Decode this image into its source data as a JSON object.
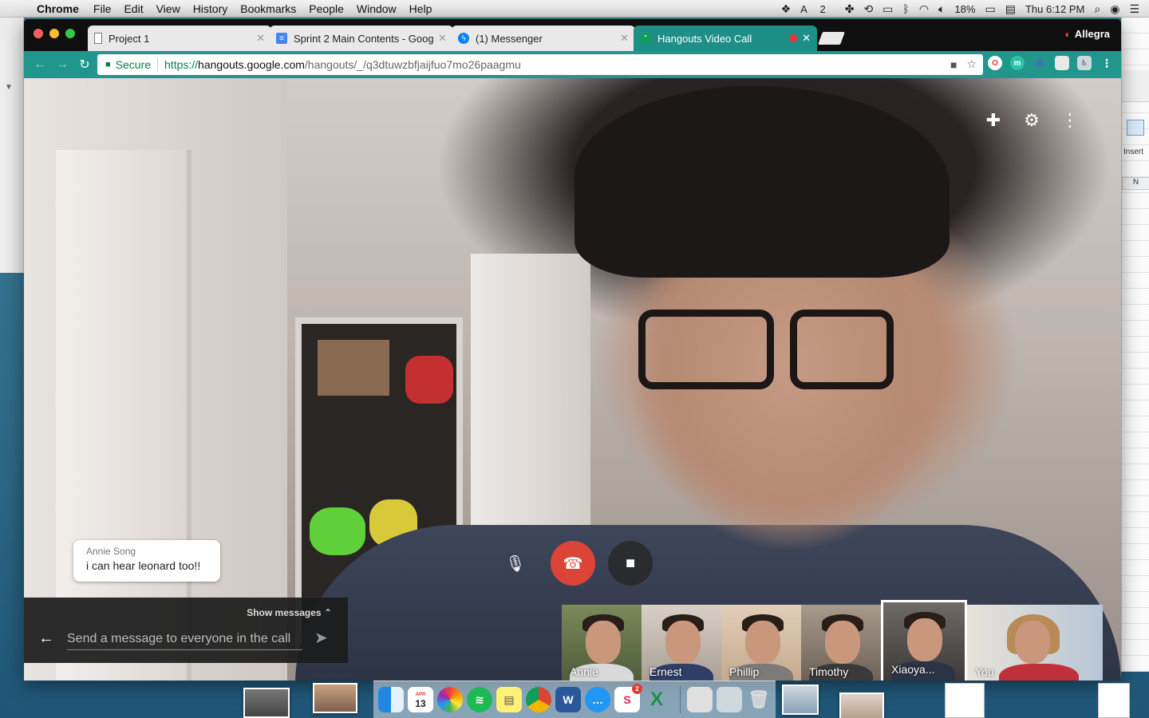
{
  "menubar": {
    "app_name": "Chrome",
    "menus": [
      "File",
      "Edit",
      "View",
      "History",
      "Bookmarks",
      "People",
      "Window",
      "Help"
    ],
    "status": {
      "adobe_count": "2",
      "battery": "18%",
      "clock": "Thu 6:12 PM"
    }
  },
  "tabs": [
    {
      "title": "Project 1",
      "icon": "document-icon"
    },
    {
      "title": "Sprint 2 Main Contents - Goog",
      "icon": "docs-icon"
    },
    {
      "title": "(1) Messenger",
      "icon": "messenger-icon"
    },
    {
      "title": "Hangouts Video Call",
      "icon": "hangouts-icon",
      "active": true
    }
  ],
  "profile_name": "Allegra",
  "omnibox": {
    "secure_label": "Secure",
    "url_scheme": "https://",
    "url_host": "hangouts.google.com",
    "url_path": "/hangouts/_/q3dtuwzbfjaijfuo7mo26paagmu"
  },
  "background_window": {
    "insert_label": "Insert",
    "column_header": "N"
  },
  "chat_bubble": {
    "sender": "Annie Song",
    "message": "i can hear leonard too!!"
  },
  "message_panel": {
    "show_label": "Show messages",
    "placeholder": "Send a message to everyone in the call"
  },
  "participants": [
    {
      "name": "Annie",
      "active": false
    },
    {
      "name": "Ernest",
      "active": false
    },
    {
      "name": "Phillip",
      "active": false
    },
    {
      "name": "Timothy",
      "active": false
    },
    {
      "name": "Xiaoya...",
      "active": true
    },
    {
      "name": "You",
      "active": false
    }
  ],
  "dock": {
    "calendar_day": "13",
    "calendar_month": "APR",
    "slack_badge": "2"
  },
  "colors": {
    "chrome_tab_active": "#1e8f86",
    "toolbar": "#20968c",
    "hangup": "#db4437",
    "secure_green": "#0b8043"
  }
}
